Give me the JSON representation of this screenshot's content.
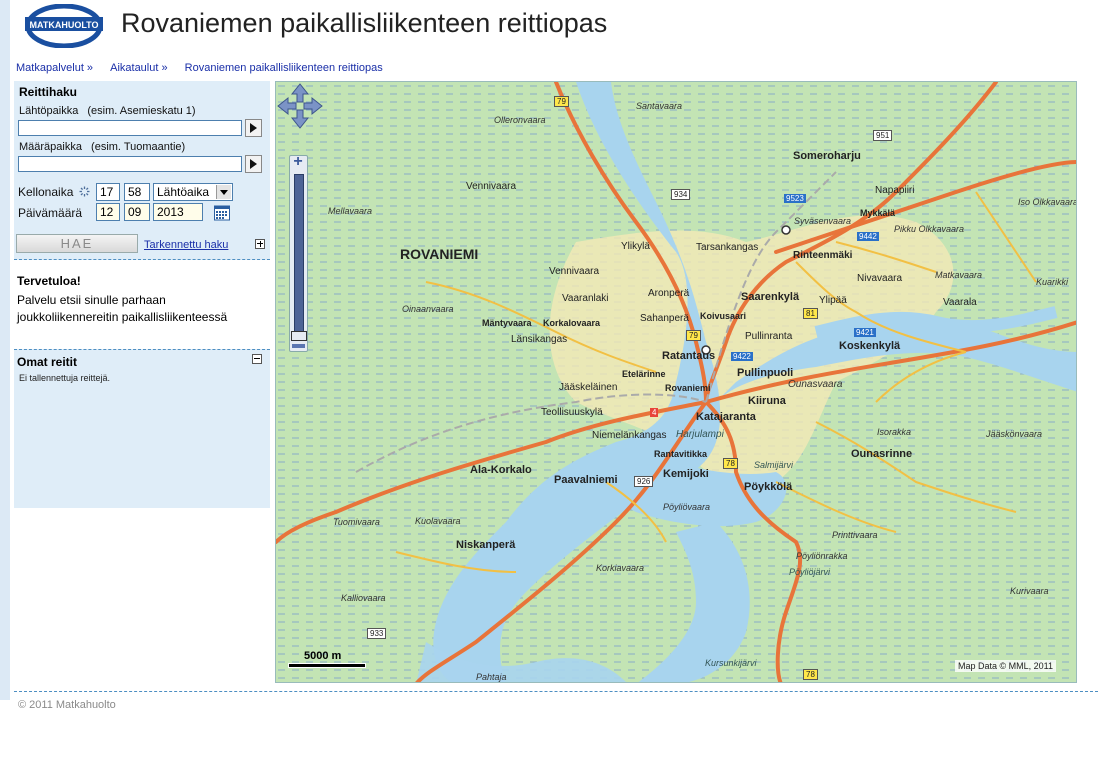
{
  "header": {
    "logo_text": "MATKAHUOLTO",
    "title": "Rovaniemen paikallisliikenteen reittiopas"
  },
  "breadcrumb": [
    {
      "label": "Matkapalvelut »"
    },
    {
      "label": "Aikataulut »"
    },
    {
      "label": "Rovaniemen paikallisliikenteen reittiopas"
    }
  ],
  "search": {
    "heading": "Reittihaku",
    "from_label": "Lähtöpaikka",
    "from_hint": "(esim. Asemieskatu 1)",
    "from_value": "",
    "to_label": "Määräpaikka",
    "to_hint": "(esim. Tuomaantie)",
    "to_value": "",
    "time_label": "Kellonaika",
    "hour": "17",
    "minute": "58",
    "time_mode": "Lähtöaika",
    "date_label": "Päivämäärä",
    "day": "12",
    "month": "09",
    "year": "2013",
    "search_button": "HAE",
    "advanced_link": "Tarkennettu haku"
  },
  "welcome": {
    "heading": "Tervetuloa!",
    "text": "Palvelu etsii sinulle parhaan joukkoliikennereitin paikallisliikenteessä"
  },
  "my_routes": {
    "heading": "Omat reitit",
    "empty_text": "Ei tallennettuja reittejä."
  },
  "map": {
    "attribution": "Map Data © MML, 2011",
    "scale_label": "5000 m",
    "labels": {
      "rovaniemi": "ROVANIEMI",
      "santavaara": "Santavaara",
      "olleronvaara": "Olleronvaara",
      "someroharju": "Someroharju",
      "vennivaara1": "Vennivaara",
      "mellavaara": "Mellavaara",
      "napapiiri": "Napapiiri",
      "iso_olkkavaara": "Iso Olkkavaara",
      "syvasenvaara": "Syväsenvaara",
      "mykkala": "Mykkälä",
      "pikku_olkkavaara": "Pikku Olkkavaara",
      "ylikyla": "Ylikylä",
      "tarsankangas": "Tarsankangas",
      "rinteenmaki": "Rinteenmäki",
      "vennivaara2": "Vennivaara",
      "nivavaara": "Nivavaara",
      "matkavaara": "Matkavaara",
      "kuarikki": "Kuarikki",
      "vaaranlaki": "Vaaranlaki",
      "aronpera": "Aronperä",
      "saarenkyla": "Saarenkylä",
      "ylipaa": "Ylipää",
      "vaarala": "Vaarala",
      "oinaanvaara": "Oinaanvaara",
      "mantyvaara": "Mäntyvaara",
      "korkalovaara": "Korkalovaara",
      "sahanpera": "Sahanperä",
      "koivusaari": "Koivusaari",
      "lansikangas": "Länsikangas",
      "pullinranta": "Pullinranta",
      "koskenkyla": "Koskenkylä",
      "ratantaus": "Ratantaus",
      "etelarinne": "Etelärinne",
      "pullinpuoli": "Pullinpuoli",
      "ounasvaara": "Ounasvaara",
      "jaaskelainen": "Jääskeläinen",
      "rovaniemi_small": "Rovaniemi",
      "kiiruna": "Kiiruna",
      "teollisuuskyla": "Teollisuuskylä",
      "katajaranta": "Katajaranta",
      "isorakka": "Isorakka",
      "jaaskonvaara": "Jääskönvaara",
      "niemelankangas": "Niemelänkangas",
      "harjulampi": "Harjulampi",
      "rantavitikka": "Rantavitikka",
      "ounasrinne": "Ounasrinne",
      "ala_korkalo": "Ala-Korkalo",
      "salmijarvi": "Salmijärvi",
      "paavalniemi": "Paavalniemi",
      "kemijoki": "Kemijoki",
      "poykkola": "Pöykkölä",
      "poylionvaara": "Pöyliövaara",
      "tuomivaara": "Tuomivaara",
      "kuolavaara": "Kuolavaara",
      "niskanpera": "Niskanperä",
      "printtivaara": "Printtivaara",
      "poylionrakka": "Pöyliönrakka",
      "korkiavaara": "Korkiavaara",
      "poyliojarvi": "Pöyliöjärvi",
      "kalliovaara": "Kalliovaara",
      "kurivaara": "Kurivaara",
      "kursunkijarvi": "Kursunkijärvi",
      "pahtaja": "Pahtaja",
      "r79a": "79",
      "r934": "934",
      "r951": "951",
      "r9523": "9523",
      "r9442": "9442",
      "r81": "81",
      "r79b": "79",
      "r9421": "9421",
      "r9422": "9422",
      "r4": "4",
      "r78a": "78",
      "r926": "926",
      "r933": "933",
      "r78b": "78"
    }
  },
  "footer": {
    "copyright": "© 2011 Matkahuolto"
  },
  "colors": {
    "accent": "#1a4fa0",
    "panel_bg": "#dfedf8",
    "link": "#1a2fa8",
    "water": "#a8d4ee",
    "land": "#bfe3b0",
    "road_major": "#f07b35",
    "road_minor": "#f8c84a"
  }
}
